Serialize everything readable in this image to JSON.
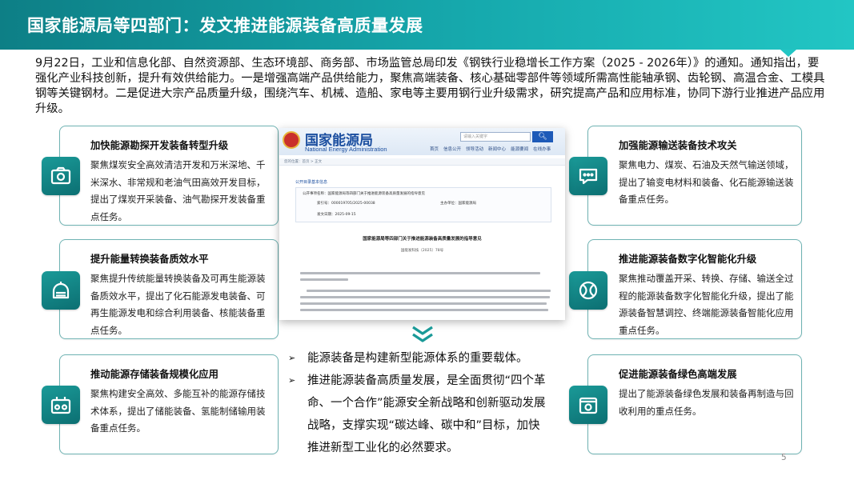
{
  "header": {
    "title": "国家能源局等四部门：发文推进能源装备高质量发展"
  },
  "intro": "9月22日，工业和信息化部、自然资源部、生态环境部、商务部、市场监管总局印发《钢铁行业稳增长工作方案（2025 - 2026年）》的通知。通知指出，要强化产业科技创新，提升有效供给能力。一是增强高端产品供给能力，聚焦高端装备、核心基础零部件等领域所需高性能轴承钢、齿轮钢、高温合金、工模具钢等关键钢材。二是促进大宗产品质量升级，围绕汽车、机械、造船、家电等主要用钢行业升级需求，研究提高产品和应用标准，协同下游行业推进产品应用升级。",
  "left_cards": [
    {
      "title": "加快能源勘探开发装备转型升级",
      "text": "聚焦煤炭安全高效清洁开发和万米深地、千米深水、非常规和老油气田高效开发目标，提出了煤炭开采装备、油气勘探开发装备重点任务。",
      "icon": "camera-icon"
    },
    {
      "title": "提升能量转换装备质效水平",
      "text": "聚焦提升传统能量转换装备及可再生能源装备质效水平，提出了化石能源发电装备、可再生能源发电和综合利用装备、核能装备重点任务。",
      "icon": "dome-icon"
    },
    {
      "title": "推动能源存储装备规模化应用",
      "text": "聚焦构建安全高效、多能互补的能源存储技术体系，提出了储能装备、氢能制储输用装备重点任务。",
      "icon": "radio-icon"
    }
  ],
  "right_cards": [
    {
      "title": "加强能源输送装备技术攻关",
      "text": "聚焦电力、煤炭、石油及天然气输送领域，提出了输变电材料和装备、化石能源输送装备重点任务。",
      "icon": "chat-icon"
    },
    {
      "title": "推进能源装备数字化智能化升级",
      "text": "聚焦推动覆盖开采、转换、存储、输送全过程的能源装备数字化智能化升级，提出了能源装备智慧调控、终端能源装备智能化应用重点任务。",
      "icon": "ball-icon"
    },
    {
      "title": "促进能源装备绿色高端发展",
      "text": "提出了能源装备绿色发展和装备再制造与回收利用的重点任务。",
      "icon": "frame-icon"
    }
  ],
  "document_screenshot": {
    "site_name": "国家能源局",
    "site_name_en": "National Energy Administration",
    "search_placeholder": "请输入关键字",
    "nav": [
      "首页",
      "信息公开",
      "领导活动",
      "新闻中心",
      "能源要闻",
      "在线办事"
    ],
    "breadcrumb": "您的位置：首页 > 正文",
    "info_title": "公开目录基本信息",
    "info_rows": [
      "公开事项名称：国家能源局等四部门关于推进能源装备高质量发展的指导意见",
      "索引号：000019705/2025-00038",
      "主办单位：国家能源局",
      "发文日期：2025-09-15"
    ],
    "heading": "国家能源局等四部门关于推进能源装备高质量发展的指导意见",
    "doc_number": "国能发科技〔2025〕78号"
  },
  "bullets": [
    "能源装备是构建新型能源体系的重要载体。",
    "推进能源装备高质量发展，是全面贯彻“四个革命、一个合作”能源安全新战略和创新驱动发展战略，支撑实现“碳达峰、碳中和”目标，加快推进新型工业化的必然要求。"
  ],
  "page_number": "5",
  "colors": {
    "teal_dark": "#0d7f86",
    "teal_light": "#22c6c4",
    "card_border": "#6fb3b3"
  }
}
